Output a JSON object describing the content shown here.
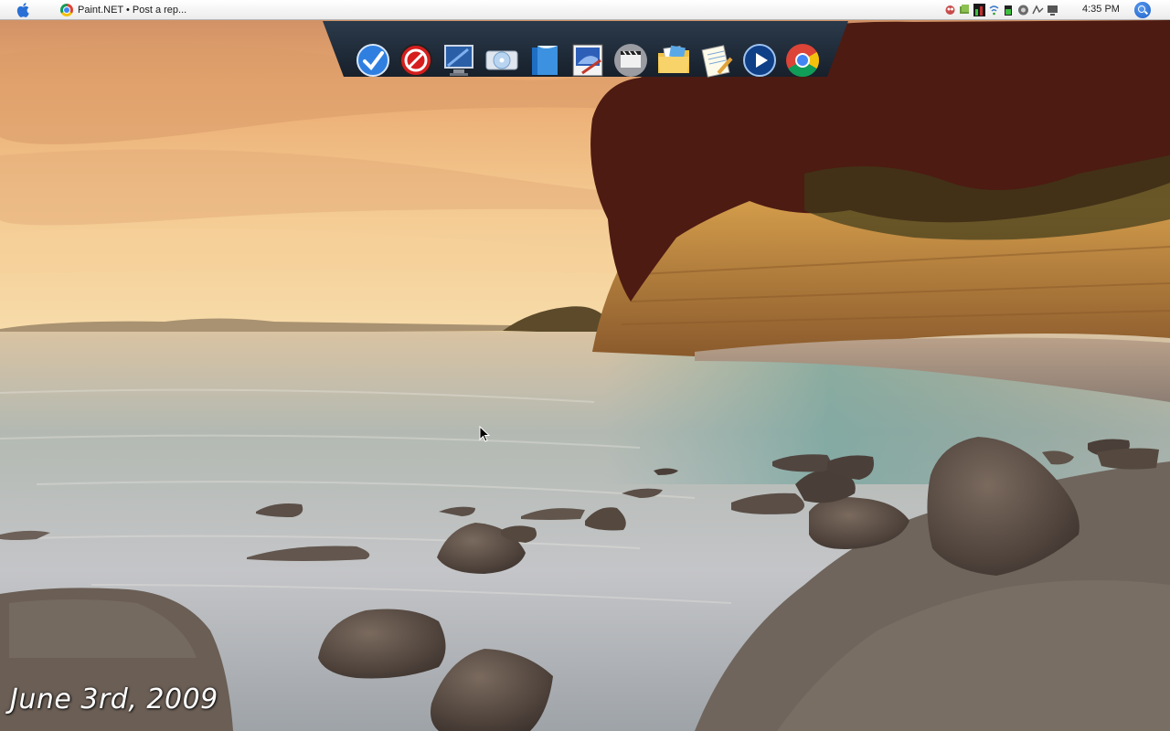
{
  "menubar": {
    "apple_icon": "apple-icon",
    "active_app": {
      "icon": "chrome-icon",
      "title": "Paint.NET • Post a rep..."
    },
    "tray_icons": [
      "adium-icon",
      "dropbox-icon",
      "cpu-monitor-icon",
      "wifi-icon",
      "battery-icon",
      "volume-icon",
      "network-icon",
      "display-icon"
    ],
    "clock": "4:35 PM",
    "spotlight_icon": "spotlight-icon"
  },
  "dock": {
    "items": [
      {
        "name": "todo-check-app",
        "icon": "checkmark-icon"
      },
      {
        "name": "blocker-app",
        "icon": "no-entry-icon"
      },
      {
        "name": "my-computer-app",
        "icon": "monitor-icon"
      },
      {
        "name": "disc-burner-app",
        "icon": "disc-icon"
      },
      {
        "name": "office-app",
        "icon": "books-icon"
      },
      {
        "name": "paint-net-app",
        "icon": "paint-icon"
      },
      {
        "name": "movie-maker-app",
        "icon": "clapperboard-icon"
      },
      {
        "name": "documents-folder",
        "icon": "folder-icon"
      },
      {
        "name": "notepad-app",
        "icon": "notepad-icon"
      },
      {
        "name": "media-player-app",
        "icon": "play-icon"
      },
      {
        "name": "chrome-app",
        "icon": "chrome-icon"
      }
    ]
  },
  "desktop": {
    "date_text": "June 3rd, 2009",
    "wallpaper": "coastal-cliff-sunset"
  },
  "colors": {
    "sky_top": "#e9a66b",
    "sky_horizon": "#f5d6a0",
    "water": "#b8c0c0",
    "cliff": "#c98a3c",
    "foliage": "#4a1a12",
    "dock_bg": "#1f2a36"
  }
}
